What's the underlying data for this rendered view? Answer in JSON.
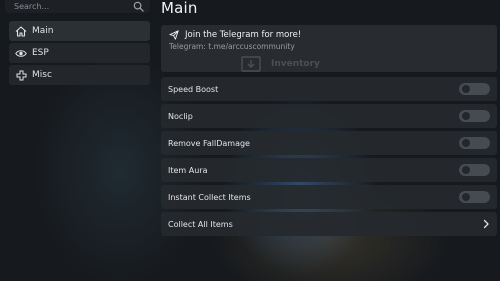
{
  "search": {
    "placeholder": "Search..."
  },
  "sidebar": {
    "items": [
      {
        "label": "Main",
        "icon": "home-icon"
      },
      {
        "label": "ESP",
        "icon": "eye-icon"
      },
      {
        "label": "Misc",
        "icon": "plus-icon"
      }
    ]
  },
  "main": {
    "title": "Main",
    "banner": {
      "title": "Join the Telegram for more!",
      "subtitle": "Telegram: t.me/arccuscommunity",
      "watermark": "Inventory"
    },
    "rows": [
      {
        "label": "Speed Boost",
        "type": "toggle",
        "enabled": false
      },
      {
        "label": "Noclip",
        "type": "toggle",
        "enabled": false
      },
      {
        "label": "Remove FallDamage",
        "type": "toggle",
        "enabled": false
      },
      {
        "label": "Item Aura",
        "type": "toggle",
        "enabled": false
      },
      {
        "label": "Instant Collect Items",
        "type": "toggle",
        "enabled": false
      },
      {
        "label": "Collect All Items",
        "type": "button"
      }
    ]
  }
}
